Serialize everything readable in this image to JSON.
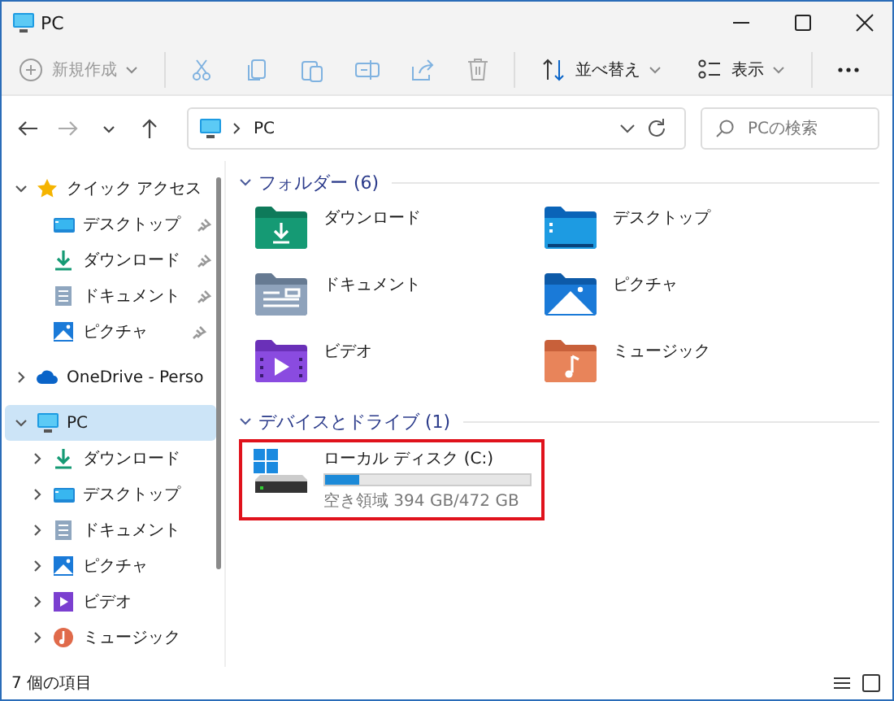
{
  "window": {
    "title": "PC"
  },
  "toolbar": [
    {
      "kind": "new",
      "label": "新規作成",
      "disabled": true
    },
    {
      "kind": "cut",
      "disabled": true
    },
    {
      "kind": "copy",
      "disabled": true
    },
    {
      "kind": "paste",
      "disabled": true
    },
    {
      "kind": "rename",
      "disabled": true
    },
    {
      "kind": "share",
      "disabled": true
    },
    {
      "kind": "delete",
      "disabled": true
    },
    {
      "kind": "sort",
      "label": "並べ替え",
      "disabled": false
    },
    {
      "kind": "view",
      "label": "表示",
      "disabled": false
    },
    {
      "kind": "more"
    }
  ],
  "navigation": [
    {
      "kind": "back",
      "disabled": false
    },
    {
      "kind": "forward",
      "disabled": true
    },
    {
      "kind": "recent",
      "disabled": false
    },
    {
      "kind": "up",
      "disabled": false
    }
  ],
  "address": {
    "path": "PC"
  },
  "search": {
    "placeholder": "PCの検索"
  },
  "sidebar": {
    "items": [
      {
        "label": "クイック アクセス",
        "kind": "star",
        "expanded": true,
        "selected": false,
        "children": [
          {
            "label": "デスクトップ",
            "kind": "desktop",
            "pinned": true,
            "selected": false
          },
          {
            "label": "ダウンロード",
            "kind": "download",
            "pinned": true,
            "selected": false
          },
          {
            "label": "ドキュメント",
            "kind": "document",
            "pinned": true,
            "selected": false
          },
          {
            "label": "ピクチャ",
            "kind": "pictures",
            "pinned": true,
            "selected": false
          }
        ]
      },
      {
        "label": "OneDrive - Perso",
        "kind": "cloud",
        "expanded": false,
        "selected": false
      },
      {
        "label": "PC",
        "kind": "pc",
        "expanded": true,
        "selected": true,
        "children": [
          {
            "label": "ダウンロード",
            "kind": "download",
            "expanded": false,
            "selected": false
          },
          {
            "label": "デスクトップ",
            "kind": "desktop",
            "expanded": false,
            "selected": false
          },
          {
            "label": "ドキュメント",
            "kind": "document",
            "expanded": false,
            "selected": false
          },
          {
            "label": "ピクチャ",
            "kind": "pictures",
            "expanded": false,
            "selected": false
          },
          {
            "label": "ビデオ",
            "kind": "video",
            "expanded": false,
            "selected": false
          },
          {
            "label": "ミュージック",
            "kind": "music",
            "expanded": false,
            "selected": false
          }
        ]
      }
    ]
  },
  "sections": [
    {
      "title": "フォルダー (6)",
      "expanded": true,
      "kind": "folders",
      "items": [
        {
          "label": "ダウンロード",
          "kind": "download"
        },
        {
          "label": "デスクトップ",
          "kind": "desktop"
        },
        {
          "label": "ドキュメント",
          "kind": "document"
        },
        {
          "label": "ピクチャ",
          "kind": "pictures"
        },
        {
          "label": "ビデオ",
          "kind": "video"
        },
        {
          "label": "ミュージック",
          "kind": "music"
        }
      ]
    },
    {
      "title": "デバイスとドライブ (1)",
      "expanded": true,
      "kind": "drives",
      "items": [
        {
          "label": "ローカル ディスク (C:)",
          "level": 0.17,
          "free": "空き領域 394 GB/472 GB",
          "highlighted": true
        }
      ]
    }
  ],
  "status_bar": {
    "text": "7 個の項目"
  }
}
